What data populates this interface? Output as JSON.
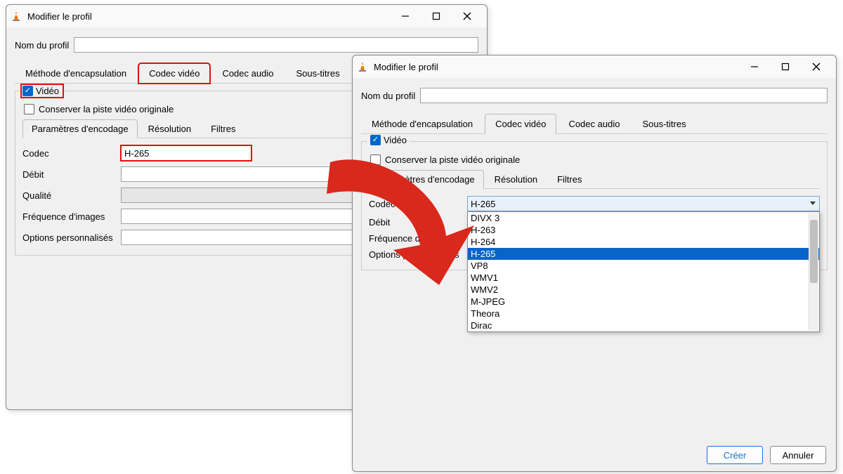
{
  "window": {
    "title": "Modifier le profil"
  },
  "profile": {
    "name_label": "Nom du profil",
    "name_value": ""
  },
  "tabs": {
    "encapsulation": "Méthode d'encapsulation",
    "video": "Codec vidéo",
    "audio": "Codec audio",
    "subs": "Sous-titres"
  },
  "video": {
    "legend": "Vidéo",
    "keep_original": "Conserver la piste vidéo originale",
    "subtabs": {
      "encoding": "Paramètres d'encodage",
      "resolution": "Résolution",
      "filters": "Filtres"
    },
    "fields": {
      "codec_label": "Codec",
      "codec_value": "H-265",
      "bitrate_label": "Débit",
      "quality_label": "Qualité",
      "fps_label": "Fréquence d'images",
      "custom_label": "Options personnalisés"
    }
  },
  "codec_dropdown": {
    "selected": "H-265",
    "options": [
      "DIVX 3",
      "H-263",
      "H-264",
      "H-265",
      "VP8",
      "WMV1",
      "WMV2",
      "M-JPEG",
      "Theora",
      "Dirac"
    ]
  },
  "buttons": {
    "create": "Créer",
    "cancel": "Annuler"
  }
}
